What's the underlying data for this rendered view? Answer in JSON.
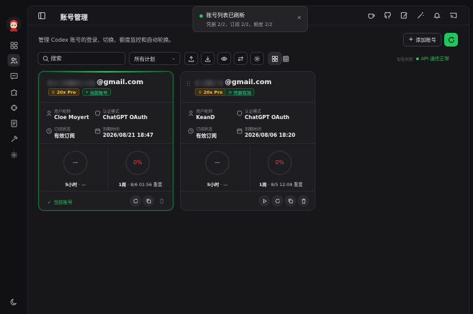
{
  "sidebar": {
    "nav_icons": [
      "grid-icon",
      "users-icon",
      "chat-icon",
      "puzzle-icon",
      "chip-icon",
      "document-icon",
      "tools-icon",
      "settings-icon"
    ],
    "bottom_icon": "moon-icon"
  },
  "header": {
    "title": "账号管理",
    "toolbar_icons": [
      "coffee-icon",
      "github-icon",
      "edit-icon",
      "magic-icon",
      "bell-icon",
      "cast-icon"
    ]
  },
  "toast": {
    "title": "账号列表已刷新",
    "subtitle": "凭据 2/2，订阅 2/2，额度 2/2",
    "close": "×"
  },
  "page": {
    "description": "管理 Codex 账号的登录、切换、额度监控和自动轮换。",
    "add_label": "添加账号"
  },
  "filters": {
    "search_placeholder": "搜索",
    "plan_selected": "所有计划",
    "auto_label": "智能刷新",
    "api_status": "API 通信正常"
  },
  "colors": {
    "accent": "#22c55e",
    "danger": "#ef4444",
    "pro": "#f2c14e"
  },
  "accounts": [
    {
      "email": "@gmail.com",
      "plan_badge": "20x Pro",
      "status_badge": "当前账号",
      "fields": {
        "user_label": "用户昵称",
        "user_value": "Cloe Moyert",
        "auth_label": "认证模式",
        "auth_value": "ChatGPT OAuth",
        "sub_label": "订阅状态",
        "sub_value": "有效订阅",
        "expire_label": "到期时间",
        "expire_value": "2026/08/21 18:47"
      },
      "quota_5h": {
        "value": "—",
        "label": "5小时",
        "reset": "· —"
      },
      "quota_week": {
        "value": "0%",
        "label": "1周",
        "reset": "· 8/6 01:56 重置"
      },
      "footer_label": "当前账号"
    },
    {
      "email": "@gmail.com",
      "plan_badge": "20x Pro",
      "status_badge": "凭据有效",
      "fields": {
        "user_label": "用户昵称",
        "user_value": "KeanD",
        "auth_label": "认证模式",
        "auth_value": "ChatGPT OAuth",
        "sub_label": "订阅状态",
        "sub_value": "有效订阅",
        "expire_label": "到期时间",
        "expire_value": "2026/08/06 18:20"
      },
      "quota_5h": {
        "value": "—",
        "label": "5小时",
        "reset": "· —"
      },
      "quota_week": {
        "value": "0%",
        "label": "1周",
        "reset": "· 8/5 12:09 重置"
      }
    }
  ]
}
